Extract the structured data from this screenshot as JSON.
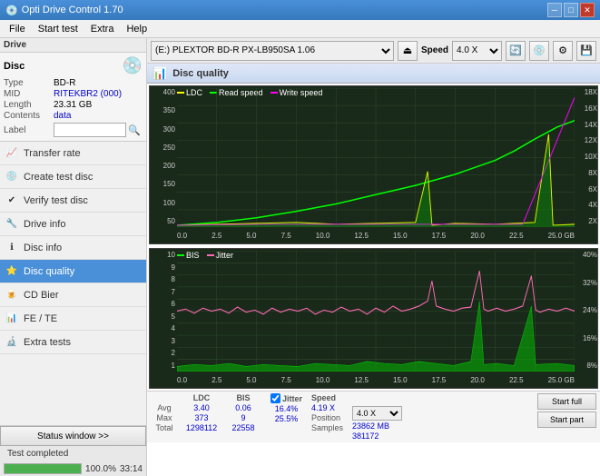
{
  "titleBar": {
    "title": "Opti Drive Control 1.70",
    "minimizeLabel": "─",
    "maximizeLabel": "□",
    "closeLabel": "✕"
  },
  "menuBar": {
    "items": [
      "File",
      "Start test",
      "Extra",
      "Help"
    ]
  },
  "driveBar": {
    "driveLabel": "Drive",
    "driveValue": "(E:)  PLEXTOR BD-R  PX-LB950SA 1.06",
    "speedLabel": "Speed",
    "speedValue": "4.0 X"
  },
  "disc": {
    "title": "Disc",
    "typeLabel": "Type",
    "typeValue": "BD-R",
    "midLabel": "MID",
    "midValue": "RITEKBR2 (000)",
    "lengthLabel": "Length",
    "lengthValue": "23.31 GB",
    "contentsLabel": "Contents",
    "contentsValue": "data",
    "labelLabel": "Label"
  },
  "navItems": [
    {
      "id": "transfer-rate",
      "label": "Transfer rate",
      "icon": "📈"
    },
    {
      "id": "create-test-disc",
      "label": "Create test disc",
      "icon": "💿"
    },
    {
      "id": "verify-test-disc",
      "label": "Verify test disc",
      "icon": "✔"
    },
    {
      "id": "drive-info",
      "label": "Drive info",
      "icon": "🔧"
    },
    {
      "id": "disc-info",
      "label": "Disc info",
      "icon": "ℹ"
    },
    {
      "id": "disc-quality",
      "label": "Disc quality",
      "icon": "⭐",
      "active": true
    },
    {
      "id": "cd-bier",
      "label": "CD Bier",
      "icon": "🍺"
    },
    {
      "id": "fe-te",
      "label": "FE / TE",
      "icon": "📊"
    },
    {
      "id": "extra-tests",
      "label": "Extra tests",
      "icon": "🔬"
    }
  ],
  "statusWindow": {
    "btnLabel": "Status window >>",
    "statusText": "Test completed",
    "progressValue": 100,
    "progressPercent": "100.0%",
    "time": "33:14"
  },
  "chartPanel": {
    "title": "Disc quality",
    "topChart": {
      "legendItems": [
        {
          "label": "LDC",
          "color": "#ffff00"
        },
        {
          "label": "Read speed",
          "color": "#00ff00"
        },
        {
          "label": "Write speed",
          "color": "#ff00ff"
        }
      ],
      "yLabels": [
        "400",
        "350",
        "300",
        "250",
        "200",
        "150",
        "100",
        "50"
      ],
      "yLabelsRight": [
        "18X",
        "16X",
        "14X",
        "12X",
        "10X",
        "8X",
        "6X",
        "4X",
        "2X"
      ],
      "xLabels": [
        "0.0",
        "2.5",
        "5.0",
        "7.5",
        "10.0",
        "12.5",
        "15.0",
        "17.5",
        "20.0",
        "22.5",
        "25.0 GB"
      ]
    },
    "bottomChart": {
      "legendItems": [
        {
          "label": "BIS",
          "color": "#00ff00"
        },
        {
          "label": "Jitter",
          "color": "#ff69b4"
        }
      ],
      "yLabels": [
        "10",
        "9",
        "8",
        "7",
        "6",
        "5",
        "4",
        "3",
        "2",
        "1"
      ],
      "yLabelsRight": [
        "40%",
        "32%",
        "24%",
        "16%",
        "8%"
      ],
      "xLabels": [
        "0.0",
        "2.5",
        "5.0",
        "7.5",
        "10.0",
        "12.5",
        "15.0",
        "17.5",
        "20.0",
        "22.5",
        "25.0 GB"
      ]
    },
    "stats": {
      "columns": [
        "",
        "LDC",
        "BIS",
        "Jitter",
        "Speed",
        ""
      ],
      "rows": [
        {
          "label": "Avg",
          "ldc": "3.40",
          "bis": "0.06",
          "jitter": "16.4%",
          "speed": "4.19 X"
        },
        {
          "label": "Max",
          "ldc": "373",
          "bis": "9",
          "jitter": "25.5%",
          "position": "23862 MB"
        },
        {
          "label": "Total",
          "ldc": "1298112",
          "bis": "22558",
          "jitter": "",
          "samples": "381172"
        }
      ],
      "jitterChecked": true,
      "speedDisplay": "4.0 X",
      "positionLabel": "Position",
      "samplesLabel": "Samples",
      "startFullLabel": "Start full",
      "startPartLabel": "Start part"
    }
  }
}
